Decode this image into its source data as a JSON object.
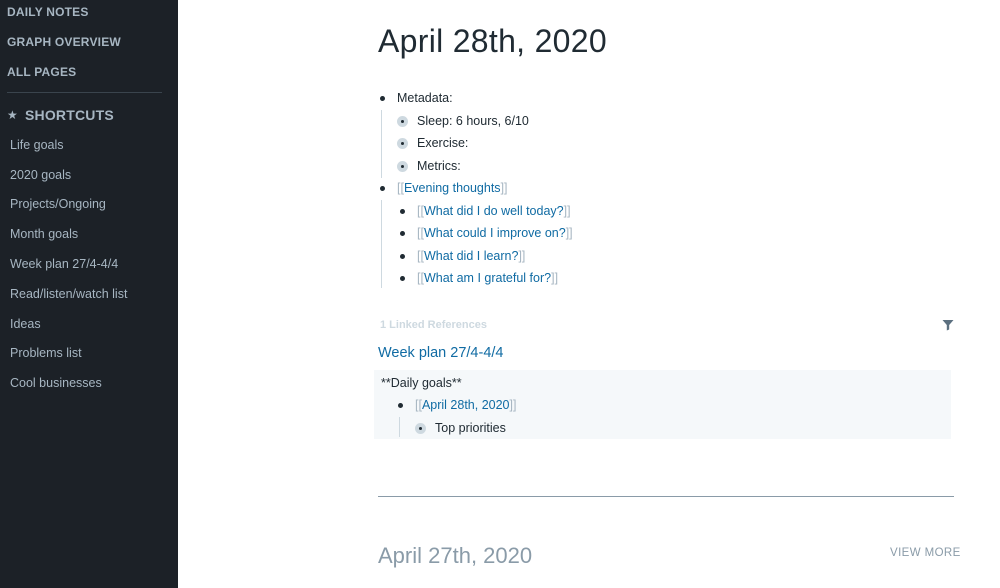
{
  "sidebar": {
    "nav": [
      "DAILY NOTES",
      "GRAPH OVERVIEW",
      "ALL PAGES"
    ],
    "shortcuts_title": "SHORTCUTS",
    "shortcuts": [
      "Life goals",
      "2020 goals",
      "Projects/Ongoing",
      "Month goals",
      "Week plan 27/4-4/4",
      "Read/listen/watch list",
      "Ideas",
      "Problems list",
      "Cool businesses"
    ]
  },
  "page": {
    "title": "April 28th, 2020",
    "blocks": {
      "metadata": "Metadata:",
      "sleep": "Sleep: 6 hours, 6/10",
      "exercise": "Exercise:",
      "metrics": "Metrics:",
      "evening": "Evening thoughts",
      "q1": "What did I do well today?",
      "q2": "What could I improve on?",
      "q3": "What did I learn?",
      "q4": "What am I grateful for?"
    },
    "brackets": {
      "open": "[[",
      "close": "]]"
    }
  },
  "references": {
    "count_label": "1 Linked References",
    "page_title": "Week plan 27/4-4/4",
    "text": "**Daily goals**",
    "link": "April 28th, 2020",
    "child": "Top priorities"
  },
  "next_day": {
    "title": "April 27th, 2020",
    "view_more": "VIEW MORE"
  }
}
